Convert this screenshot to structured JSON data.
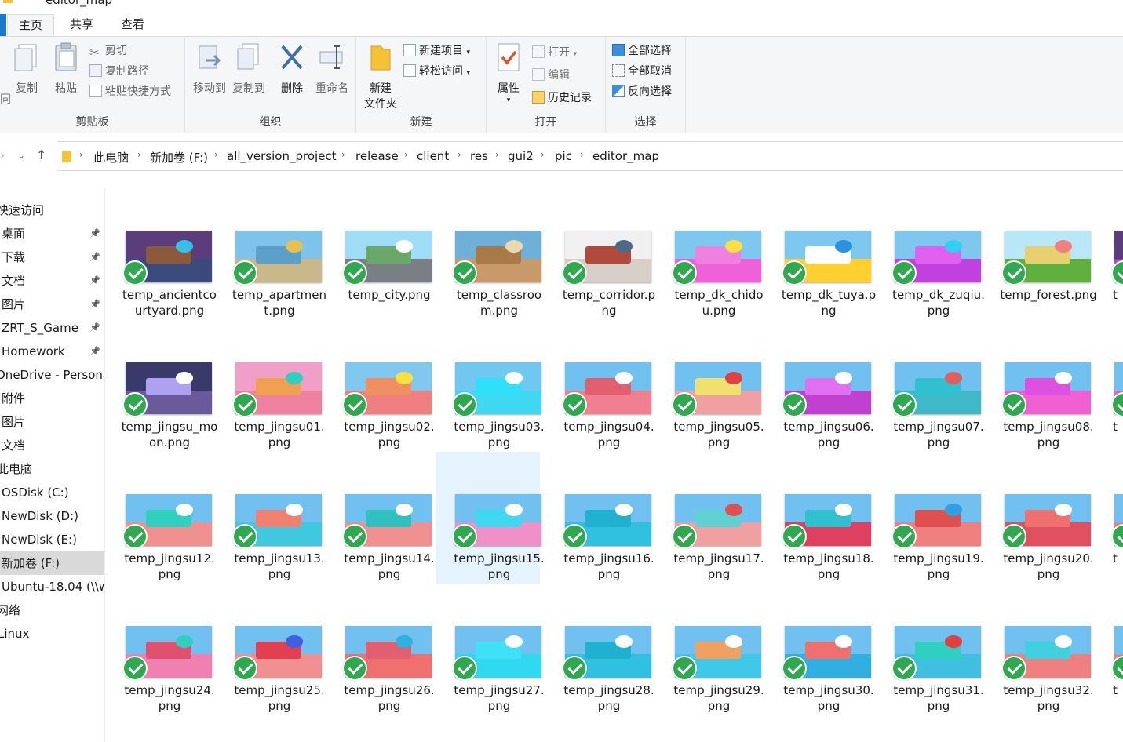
{
  "window": {
    "title": "editor_map"
  },
  "tabs": [
    {
      "label": "主页",
      "active": true
    },
    {
      "label": "共享",
      "active": false
    },
    {
      "label": "查看",
      "active": false
    }
  ],
  "ribbon": {
    "clipboard": {
      "label": "剪贴板",
      "copy": "复制",
      "paste": "粘贴",
      "cut": "剪切",
      "copy_path": "复制路径",
      "paste_shortcut": "粘贴快捷方式",
      "left_clip": "同"
    },
    "organize": {
      "label": "组织",
      "move_to": "移动到",
      "copy_to": "复制到",
      "delete": "删除",
      "rename": "重命名"
    },
    "new": {
      "label": "新建",
      "new_folder": "新建\n文件夹",
      "new_folder_l1": "新建",
      "new_folder_l2": "文件夹",
      "new_item": "新建项目",
      "easy_access": "轻松访问"
    },
    "open": {
      "label": "打开",
      "properties": "属性",
      "open": "打开",
      "edit": "编辑",
      "history": "历史记录"
    },
    "select": {
      "label": "选择",
      "select_all": "全部选择",
      "select_none": "全部取消",
      "invert": "反向选择"
    }
  },
  "address": {
    "crumbs": [
      "此电脑",
      "新加卷 (F:)",
      "all_version_project",
      "release",
      "client",
      "res",
      "gui2",
      "pic",
      "editor_map"
    ]
  },
  "nav": [
    {
      "label": "快速访问",
      "pinned": false,
      "selected": false
    },
    {
      "label": "桌面",
      "pinned": true,
      "selected": false
    },
    {
      "label": "下载",
      "pinned": true,
      "selected": false
    },
    {
      "label": "文档",
      "pinned": true,
      "selected": false
    },
    {
      "label": "图片",
      "pinned": true,
      "selected": false
    },
    {
      "label": "ZRT_S_Game",
      "pinned": true,
      "selected": false
    },
    {
      "label": "Homework",
      "pinned": true,
      "selected": false
    },
    {
      "label": "OneDrive - Persona",
      "pinned": false,
      "selected": false
    },
    {
      "label": "附件",
      "pinned": false,
      "selected": false
    },
    {
      "label": "图片",
      "pinned": false,
      "selected": false
    },
    {
      "label": "文档",
      "pinned": false,
      "selected": false
    },
    {
      "label": "此电脑",
      "pinned": false,
      "selected": false
    },
    {
      "label": "OSDisk (C:)",
      "pinned": false,
      "selected": false
    },
    {
      "label": "NewDisk (D:)",
      "pinned": false,
      "selected": false
    },
    {
      "label": "NewDisk (E:)",
      "pinned": false,
      "selected": false
    },
    {
      "label": "新加卷 (F:)",
      "pinned": false,
      "selected": true
    },
    {
      "label": "Ubuntu-18.04 (\\\\w",
      "pinned": false,
      "selected": false
    },
    {
      "label": "网络",
      "pinned": false,
      "selected": false
    },
    {
      "label": "Linux",
      "pinned": false,
      "selected": false
    }
  ],
  "files": [
    {
      "name": "temp_ancientcourtyard.png",
      "sky": "#5a3d7a",
      "ground": "#3a4a7a",
      "obj": "#8a5a3a",
      "accent": "#35c0e8",
      "selected": false
    },
    {
      "name": "temp_apartment.png",
      "sky": "#7ec3ea",
      "ground": "#c9b98a",
      "obj": "#5aa0c8",
      "accent": "#e8c050",
      "selected": false
    },
    {
      "name": "temp_city.png",
      "sky": "#9fdcf5",
      "ground": "#7a7f86",
      "obj": "#6aa86a",
      "accent": "#ffffff",
      "selected": false
    },
    {
      "name": "temp_classroom.png",
      "sky": "#6fb0d8",
      "ground": "#c89a6a",
      "obj": "#a87a4a",
      "accent": "#e8d8b0",
      "selected": false
    },
    {
      "name": "temp_corridor.png",
      "sky": "#f0f0f0",
      "ground": "#d8d0c8",
      "obj": "#b04a3a",
      "accent": "#4a6a8a",
      "selected": false
    },
    {
      "name": "temp_dk_chidou.png",
      "sky": "#7ec8f0",
      "ground": "#f060d8",
      "obj": "#f080e0",
      "accent": "#ffe040",
      "selected": false
    },
    {
      "name": "temp_dk_tuya.png",
      "sky": "#7ec8f0",
      "ground": "#ffd030",
      "obj": "#ffffff",
      "accent": "#2a90e0",
      "selected": false
    },
    {
      "name": "temp_dk_zuqiu.png",
      "sky": "#7ec8f0",
      "ground": "#c040e0",
      "obj": "#e060f0",
      "accent": "#30d0f0",
      "selected": false
    },
    {
      "name": "temp_forest.png",
      "sky": "#b8e8f8",
      "ground": "#60b040",
      "obj": "#e8d070",
      "accent": "#f08080",
      "selected": false
    },
    {
      "name": "temp_jingsu_moon.png",
      "sky": "#3a3a6a",
      "ground": "#6a5a9a",
      "obj": "#b0a0f0",
      "accent": "#ffffff",
      "selected": false
    },
    {
      "name": "temp_jingsu01.png",
      "sky": "#f0a0c8",
      "ground": "#f080a0",
      "obj": "#f0a050",
      "accent": "#30d0c0",
      "selected": false
    },
    {
      "name": "temp_jingsu02.png",
      "sky": "#80c8f0",
      "ground": "#f08080",
      "obj": "#f09060",
      "accent": "#ffe040",
      "selected": false
    },
    {
      "name": "temp_jingsu03.png",
      "sky": "#70c8f0",
      "ground": "#40d8f0",
      "obj": "#30e0f8",
      "accent": "#ffffff",
      "selected": false
    },
    {
      "name": "temp_jingsu04.png",
      "sky": "#70c0f0",
      "ground": "#f08090",
      "obj": "#e06070",
      "accent": "#ffffff",
      "selected": false
    },
    {
      "name": "temp_jingsu05.png",
      "sky": "#70c0f0",
      "ground": "#f0a0a0",
      "obj": "#f0e070",
      "accent": "#e04040",
      "selected": false
    },
    {
      "name": "temp_jingsu06.png",
      "sky": "#70c0f0",
      "ground": "#c040d0",
      "obj": "#e070f0",
      "accent": "#ffffff",
      "selected": false
    },
    {
      "name": "temp_jingsu07.png",
      "sky": "#70c0f0",
      "ground": "#40b8c8",
      "obj": "#30c0d0",
      "accent": "#e06060",
      "selected": false
    },
    {
      "name": "temp_jingsu08.png",
      "sky": "#70c0f0",
      "ground": "#f060d0",
      "obj": "#e050e0",
      "accent": "#ffffff",
      "selected": false
    },
    {
      "name": "temp_jingsu12.png",
      "sky": "#70c0f0",
      "ground": "#f09090",
      "obj": "#30d0c0",
      "accent": "#ffffff",
      "selected": false
    },
    {
      "name": "temp_jingsu13.png",
      "sky": "#70c0f0",
      "ground": "#40c8e0",
      "obj": "#f08070",
      "accent": "#ffffff",
      "selected": false
    },
    {
      "name": "temp_jingsu14.png",
      "sky": "#70c0f0",
      "ground": "#f09090",
      "obj": "#30c0c0",
      "accent": "#ffffff",
      "selected": false
    },
    {
      "name": "temp_jingsu15.png",
      "sky": "#70c0f0",
      "ground": "#f090c8",
      "obj": "#40d8f0",
      "accent": "#ffffff",
      "selected": true
    },
    {
      "name": "temp_jingsu16.png",
      "sky": "#70c0f0",
      "ground": "#30c0e0",
      "obj": "#20b0d0",
      "accent": "#ffffff",
      "selected": false
    },
    {
      "name": "temp_jingsu17.png",
      "sky": "#70c0f0",
      "ground": "#f0a0a0",
      "obj": "#60d0d0",
      "accent": "#e05050",
      "selected": false
    },
    {
      "name": "temp_jingsu18.png",
      "sky": "#70c0f0",
      "ground": "#e04060",
      "obj": "#30c0d0",
      "accent": "#ffffff",
      "selected": false
    },
    {
      "name": "temp_jingsu19.png",
      "sky": "#70c0f0",
      "ground": "#f08080",
      "obj": "#e05050",
      "accent": "#30a0e0",
      "selected": false
    },
    {
      "name": "temp_jingsu20.png",
      "sky": "#70c0f0",
      "ground": "#e05060",
      "obj": "#f07070",
      "accent": "#ffffff",
      "selected": false
    },
    {
      "name": "temp_jingsu24.png",
      "sky": "#70c0f0",
      "ground": "#f080b0",
      "obj": "#e05070",
      "accent": "#30d0c0",
      "selected": false
    },
    {
      "name": "temp_jingsu25.png",
      "sky": "#70c0f0",
      "ground": "#f09090",
      "obj": "#e04050",
      "accent": "#4060e0",
      "selected": false
    },
    {
      "name": "temp_jingsu26.png",
      "sky": "#70c0f0",
      "ground": "#f07070",
      "obj": "#e06070",
      "accent": "#30b0e0",
      "selected": false
    },
    {
      "name": "temp_jingsu27.png",
      "sky": "#70c0f0",
      "ground": "#30d8f0",
      "obj": "#40e0f8",
      "accent": "#ffffff",
      "selected": false
    },
    {
      "name": "temp_jingsu28.png",
      "sky": "#70c0f0",
      "ground": "#30c0e0",
      "obj": "#20b0d0",
      "accent": "#ffffff",
      "selected": false
    },
    {
      "name": "temp_jingsu29.png",
      "sky": "#70c0f0",
      "ground": "#40c8e8",
      "obj": "#f0a060",
      "accent": "#ffffff",
      "selected": false
    },
    {
      "name": "temp_jingsu30.png",
      "sky": "#70c0f0",
      "ground": "#30b0e0",
      "obj": "#f07070",
      "accent": "#ffffff",
      "selected": false
    },
    {
      "name": "temp_jingsu31.png",
      "sky": "#70c0f0",
      "ground": "#40c0e0",
      "obj": "#30d0c0",
      "accent": "#e04040",
      "selected": false
    },
    {
      "name": "temp_jingsu32.png",
      "sky": "#70c0f0",
      "ground": "#f08080",
      "obj": "#40d0e0",
      "accent": "#ffffff",
      "selected": false
    }
  ],
  "partial_column": [
    {
      "name": "t",
      "sky": "#5a3d7a",
      "ground": "#c040e0"
    },
    {
      "name": "t",
      "sky": "#70c0f0",
      "ground": "#f060d0"
    },
    {
      "name": "t",
      "sky": "#70c0f0",
      "ground": "#f08080"
    },
    {
      "name": "t",
      "sky": "#70c0f0",
      "ground": "#f08080"
    }
  ],
  "colors": {
    "accent_blue": "#1979ca",
    "check_green": "#2fa84f",
    "selected_item_bg": "#e5f3ff",
    "nav_selected_bg": "#d9d9d9"
  },
  "icons": {
    "pin": "pin-icon",
    "check": "sync-check-icon",
    "folder": "folder-icon"
  }
}
